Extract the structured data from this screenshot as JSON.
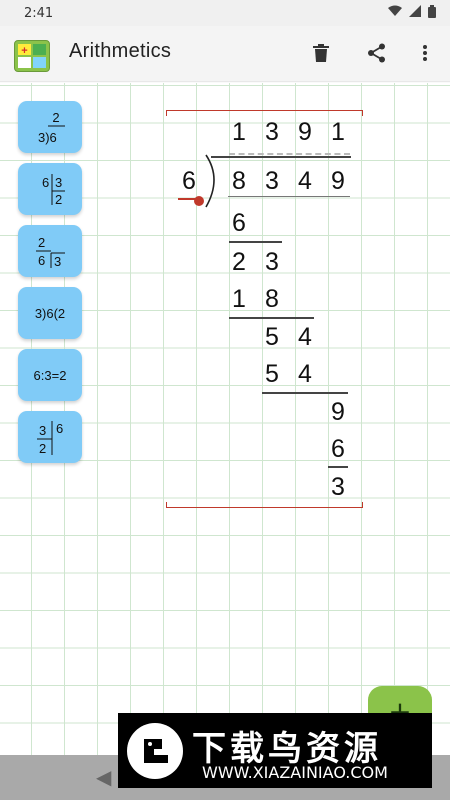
{
  "status": {
    "time": "2:41"
  },
  "app": {
    "title": "Arithmetics"
  },
  "toolbar": {
    "delete_icon": "trash-icon",
    "share_icon": "share-icon",
    "menu_icon": "more-vert-icon"
  },
  "side_buttons": [
    {
      "name": "long-division-style-1"
    },
    {
      "name": "division-style-2"
    },
    {
      "name": "division-style-3"
    },
    {
      "name": "division-style-4",
      "text": "3)6(2"
    },
    {
      "name": "division-style-5",
      "text": "6:3=2"
    },
    {
      "name": "division-style-6"
    }
  ],
  "division": {
    "quotient": [
      "1",
      "3",
      "9",
      "1"
    ],
    "divisor": "6",
    "dividend": [
      "8",
      "3",
      "4",
      "9"
    ],
    "steps": [
      [
        "6"
      ],
      [
        "2",
        "3"
      ],
      [
        "1",
        "8"
      ],
      [
        "5",
        "4"
      ],
      [
        "5",
        "4"
      ],
      [
        "9"
      ],
      [
        "6"
      ],
      [
        "3"
      ]
    ]
  },
  "fab": {
    "label": "+"
  },
  "watermark": {
    "title": "下载鸟资源",
    "url": "WWW.XIAZAINIAO.COM"
  },
  "colors": {
    "accent": "#8bc34a",
    "side_button": "#80cbf7",
    "bracket": "#c0392b"
  }
}
